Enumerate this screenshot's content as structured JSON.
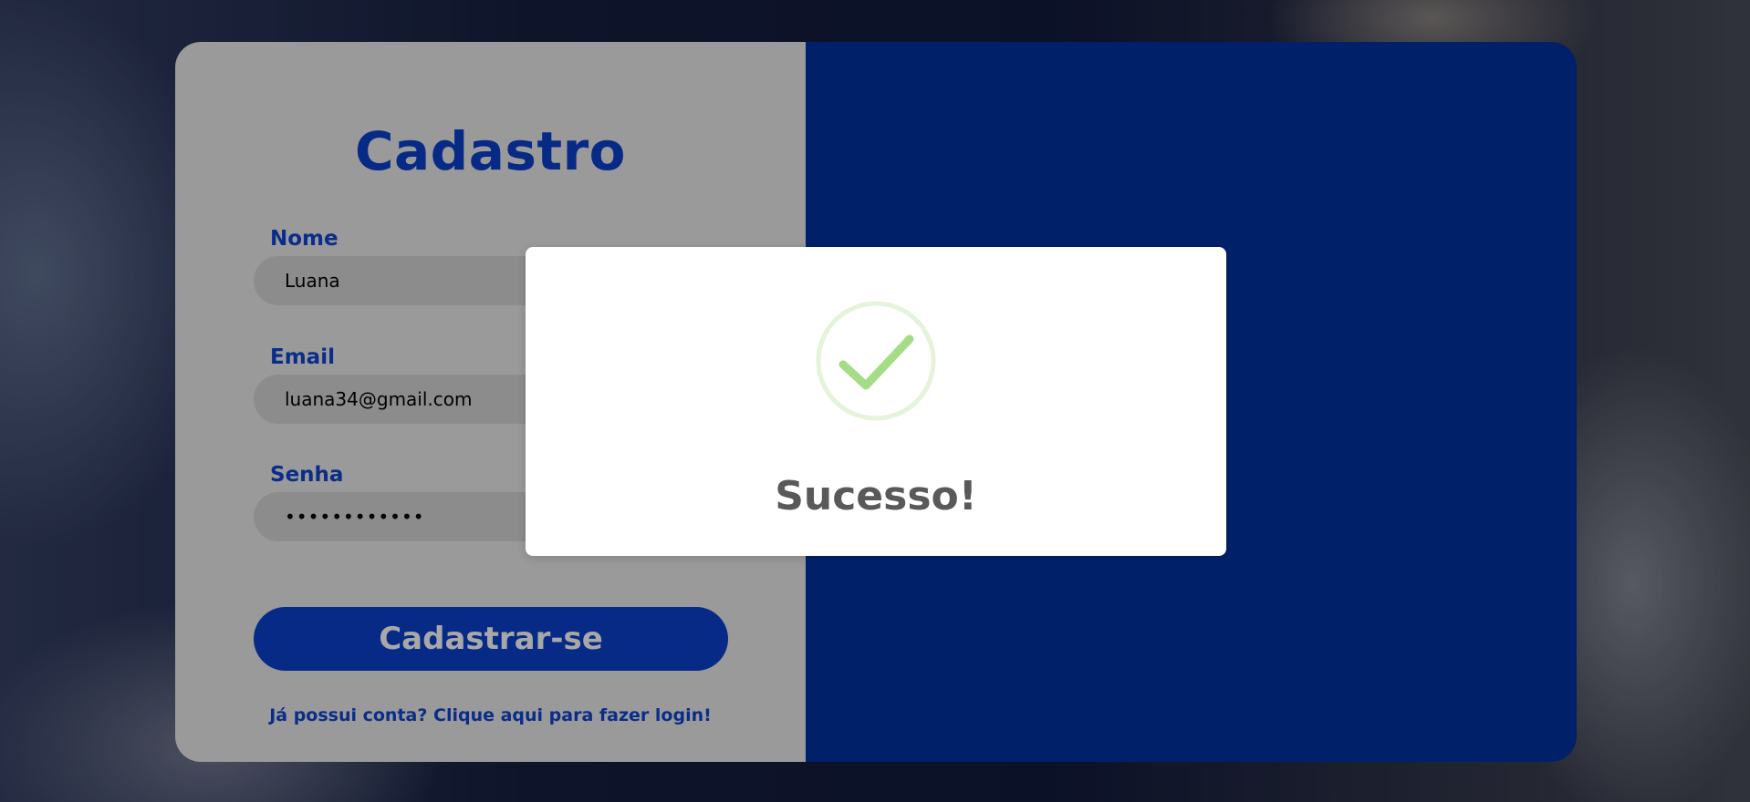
{
  "form": {
    "title": "Cadastro",
    "fields": [
      {
        "label": "Nome",
        "value": "Luana"
      },
      {
        "label": "Email",
        "value": "luana34@gmail.com"
      },
      {
        "label": "Senha",
        "value": "••••••••••••"
      }
    ],
    "submit_label": "Cadastrar-se",
    "login_link": "Já possui conta? Clique aqui para fazer login!"
  },
  "modal": {
    "title": "Sucesso!",
    "icon": "success-check-icon"
  },
  "colors": {
    "primary": "#062a86",
    "panel_right": "#00216a",
    "panel_left": "#9a9a9a",
    "success_green": "#a5dc86"
  }
}
